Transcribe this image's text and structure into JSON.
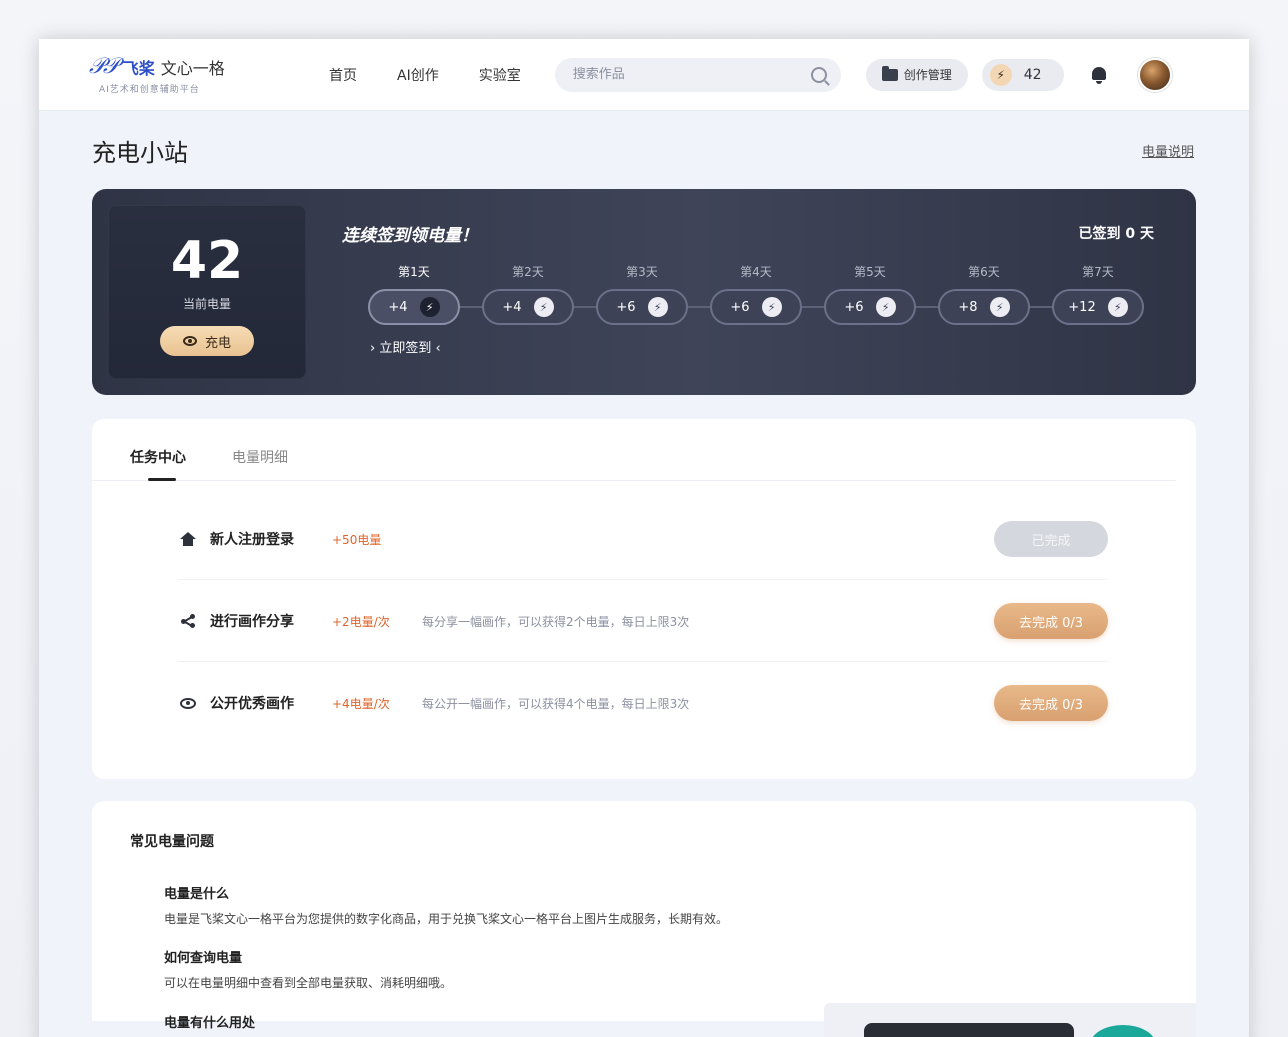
{
  "header": {
    "logo_mark": "飞",
    "logo_name": "飞桨",
    "logo_name2": "文心一格",
    "logo_sub": "AI艺术和创意辅助平台",
    "nav": [
      "首页",
      "AI创作",
      "实验室"
    ],
    "search_placeholder": "搜索作品",
    "manage_label": "创作管理",
    "energy_count": "42"
  },
  "page": {
    "title": "充电小站",
    "energy_desc_link": "电量说明"
  },
  "banner": {
    "balance": "42",
    "balance_label": "当前电量",
    "charge_label": "充电",
    "checkin_title": "连续签到领电量！",
    "checkin_status": "已签到 0 天",
    "checkin_now": "› 立即签到 ‹",
    "days": [
      {
        "label": "第1天",
        "reward": "+4"
      },
      {
        "label": "第2天",
        "reward": "+4"
      },
      {
        "label": "第3天",
        "reward": "+6"
      },
      {
        "label": "第4天",
        "reward": "+6"
      },
      {
        "label": "第5天",
        "reward": "+6"
      },
      {
        "label": "第6天",
        "reward": "+8"
      },
      {
        "label": "第7天",
        "reward": "+12"
      }
    ]
  },
  "tasks": {
    "tabs": [
      "任务中心",
      "电量明细"
    ],
    "items": [
      {
        "name": "新人注册登录",
        "reward": "+50电量",
        "desc": "",
        "button": "已完成"
      },
      {
        "name": "进行画作分享",
        "reward": "+2电量/次",
        "desc": "每分享一幅画作，可以获得2个电量，每日上限3次",
        "button": "去完成 0/3"
      },
      {
        "name": "公开优秀画作",
        "reward": "+4电量/次",
        "desc": "每公开一幅画作，可以获得4个电量，每日上限3次",
        "button": "去完成 0/3"
      }
    ]
  },
  "faq": {
    "title": "常见电量问题",
    "items": [
      {
        "q": "电量是什么",
        "a": "电量是飞桨文心一格平台为您提供的数字化商品，用于兑换飞桨文心一格平台上图片生成服务，长期有效。"
      },
      {
        "q": "如何查询电量",
        "a": "可以在电量明细中查看到全部电量获取、消耗明细哦。"
      },
      {
        "q": "电量有什么用处",
        "a": ""
      }
    ]
  }
}
